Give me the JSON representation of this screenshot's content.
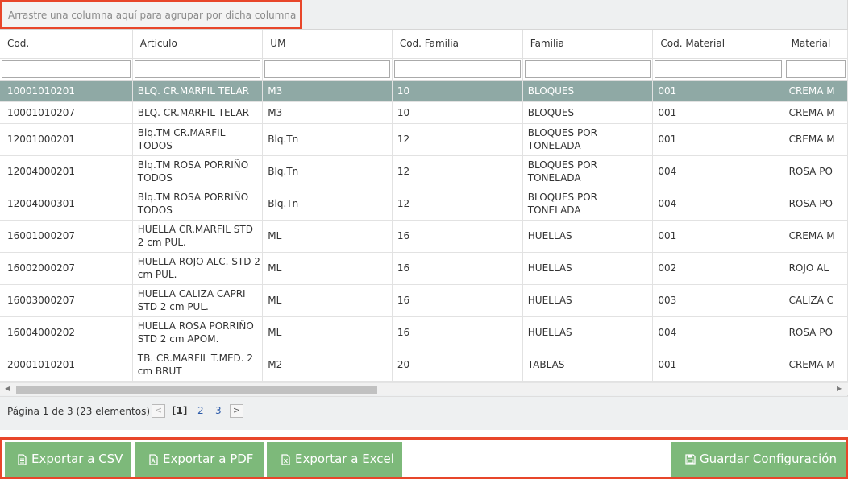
{
  "group_panel": {
    "placeholder": "Arrastre una columna aquí para agrupar por dicha columna"
  },
  "columns": [
    "Cod.",
    "Articulo",
    "UM",
    "Cod. Familia",
    "Familia",
    "Cod. Material",
    "Material"
  ],
  "rows": [
    {
      "cod": "10001010201",
      "articulo": "BLQ. CR.MARFIL TELAR",
      "um": "M3",
      "cod_familia": "10",
      "familia": "BLOQUES",
      "cod_material": "001",
      "material": "CREMA M",
      "selected": true
    },
    {
      "cod": "10001010207",
      "articulo": "BLQ. CR.MARFIL TELAR",
      "um": "M3",
      "cod_familia": "10",
      "familia": "BLOQUES",
      "cod_material": "001",
      "material": "CREMA M"
    },
    {
      "cod": "12001000201",
      "articulo": "Blq.TM CR.MARFIL TODOS",
      "um": "Blq.Tn",
      "cod_familia": "12",
      "familia": "BLOQUES POR TONELADA",
      "cod_material": "001",
      "material": "CREMA M"
    },
    {
      "cod": "12004000201",
      "articulo": "Blq.TM ROSA PORRIÑO TODOS",
      "um": "Blq.Tn",
      "cod_familia": "12",
      "familia": "BLOQUES POR TONELADA",
      "cod_material": "004",
      "material": "ROSA PO"
    },
    {
      "cod": "12004000301",
      "articulo": "Blq.TM ROSA PORRIÑO TODOS",
      "um": "Blq.Tn",
      "cod_familia": "12",
      "familia": "BLOQUES POR TONELADA",
      "cod_material": "004",
      "material": "ROSA PO"
    },
    {
      "cod": "16001000207",
      "articulo": "HUELLA CR.MARFIL STD 2 cm PUL.",
      "um": "ML",
      "cod_familia": "16",
      "familia": "HUELLAS",
      "cod_material": "001",
      "material": "CREMA M"
    },
    {
      "cod": "16002000207",
      "articulo": "HUELLA ROJO ALC. STD 2 cm PUL.",
      "um": "ML",
      "cod_familia": "16",
      "familia": "HUELLAS",
      "cod_material": "002",
      "material": "ROJO AL"
    },
    {
      "cod": "16003000207",
      "articulo": "HUELLA CALIZA CAPRI STD 2 cm PUL.",
      "um": "ML",
      "cod_familia": "16",
      "familia": "HUELLAS",
      "cod_material": "003",
      "material": "CALIZA C"
    },
    {
      "cod": "16004000202",
      "articulo": "HUELLA ROSA PORRIÑO STD 2 cm APOM.",
      "um": "ML",
      "cod_familia": "16",
      "familia": "HUELLAS",
      "cod_material": "004",
      "material": "ROSA PO"
    },
    {
      "cod": "20001010201",
      "articulo": "TB. CR.MARFIL T.MED. 2 cm BRUT",
      "um": "M2",
      "cod_familia": "20",
      "familia": "TABLAS",
      "cod_material": "001",
      "material": "CREMA M"
    }
  ],
  "pager": {
    "summary": "Página 1 de 3 (23 elementos)",
    "prev": "<",
    "current": "[1]",
    "page2": "2",
    "page3": "3",
    "next": ">"
  },
  "toolbar": {
    "export_csv": "Exportar a CSV",
    "export_pdf": "Exportar a PDF",
    "export_excel": "Exportar a Excel",
    "save_config": "Guardar Configuración"
  },
  "colors": {
    "selected_row": "#8fa9a5",
    "toolbar_button": "#7db97a",
    "highlight_border": "#e8462a"
  }
}
